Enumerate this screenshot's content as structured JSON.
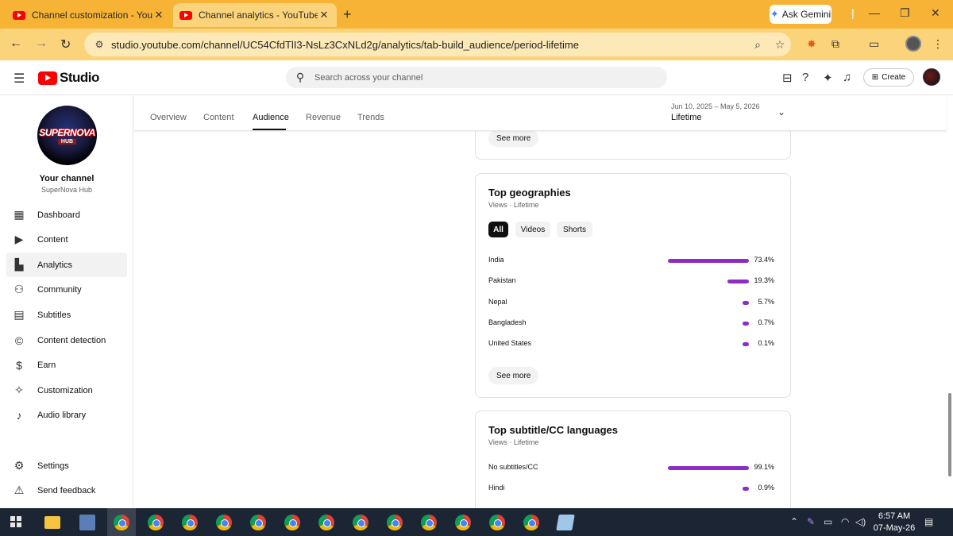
{
  "browser": {
    "tabs": [
      {
        "title": "Channel customization - YouTu"
      },
      {
        "title": "Channel analytics - YouTube St"
      }
    ],
    "new_tab": "+",
    "ask_gemini": "Ask Gemini",
    "url": "studio.youtube.com/channel/UC54CfdTlI3-NsLz3CxNLd2g/analytics/tab-build_audience/period-lifetime"
  },
  "studio": {
    "logo_text": "Studio",
    "search_placeholder": "Search across your channel",
    "create_label": "Create"
  },
  "channel": {
    "avatar_line1": "SUPERNOVA",
    "avatar_line2": "HUB",
    "title": "Your channel",
    "name": "SuperNova Hub"
  },
  "sidebar": {
    "items": [
      {
        "label": "Dashboard",
        "icon": "dashboard-icon"
      },
      {
        "label": "Content",
        "icon": "content-icon"
      },
      {
        "label": "Analytics",
        "icon": "analytics-icon",
        "active": true
      },
      {
        "label": "Community",
        "icon": "community-icon"
      },
      {
        "label": "Subtitles",
        "icon": "subtitles-icon"
      },
      {
        "label": "Content detection",
        "icon": "copyright-icon"
      },
      {
        "label": "Earn",
        "icon": "dollar-icon"
      },
      {
        "label": "Customization",
        "icon": "magic-wand-icon"
      },
      {
        "label": "Audio library",
        "icon": "audio-library-icon"
      }
    ],
    "settings": "Settings",
    "feedback": "Send feedback"
  },
  "analytics": {
    "tabs": [
      "Overview",
      "Content",
      "Audience",
      "Revenue",
      "Trends"
    ],
    "active_tab": "Audience",
    "period_range": "Jun 10, 2025 – May 5, 2026",
    "period_label": "Lifetime"
  },
  "cards": {
    "prev_see_more": "See more",
    "geographies": {
      "title": "Top geographies",
      "subtitle": "Views · Lifetime",
      "filters": [
        "All",
        "Videos",
        "Shorts"
      ],
      "active_filter": "All",
      "see_more": "See more",
      "rows": [
        {
          "name": "India",
          "value": "73.4%",
          "percent": 73.4
        },
        {
          "name": "Pakistan",
          "value": "19.3%",
          "percent": 19.3
        },
        {
          "name": "Nepal",
          "value": "5.7%",
          "percent": 5.7
        },
        {
          "name": "Bangladesh",
          "value": "0.7%",
          "percent": 0.7
        },
        {
          "name": "United States",
          "value": "0.1%",
          "percent": 0.1
        }
      ]
    },
    "subtitles": {
      "title": "Top subtitle/CC languages",
      "subtitle": "Views · Lifetime",
      "rows": [
        {
          "name": "No subtitles/CC",
          "value": "99.1%",
          "percent": 99.1
        },
        {
          "name": "Hindi",
          "value": "0.9%",
          "percent": 0.9
        }
      ]
    }
  },
  "taskbar": {
    "time": "6:57 AM",
    "date": "07-May-26"
  },
  "colors": {
    "bar": "#8d2dc4",
    "browser_frame": "#f6b335",
    "yt_red": "#ff0000"
  }
}
